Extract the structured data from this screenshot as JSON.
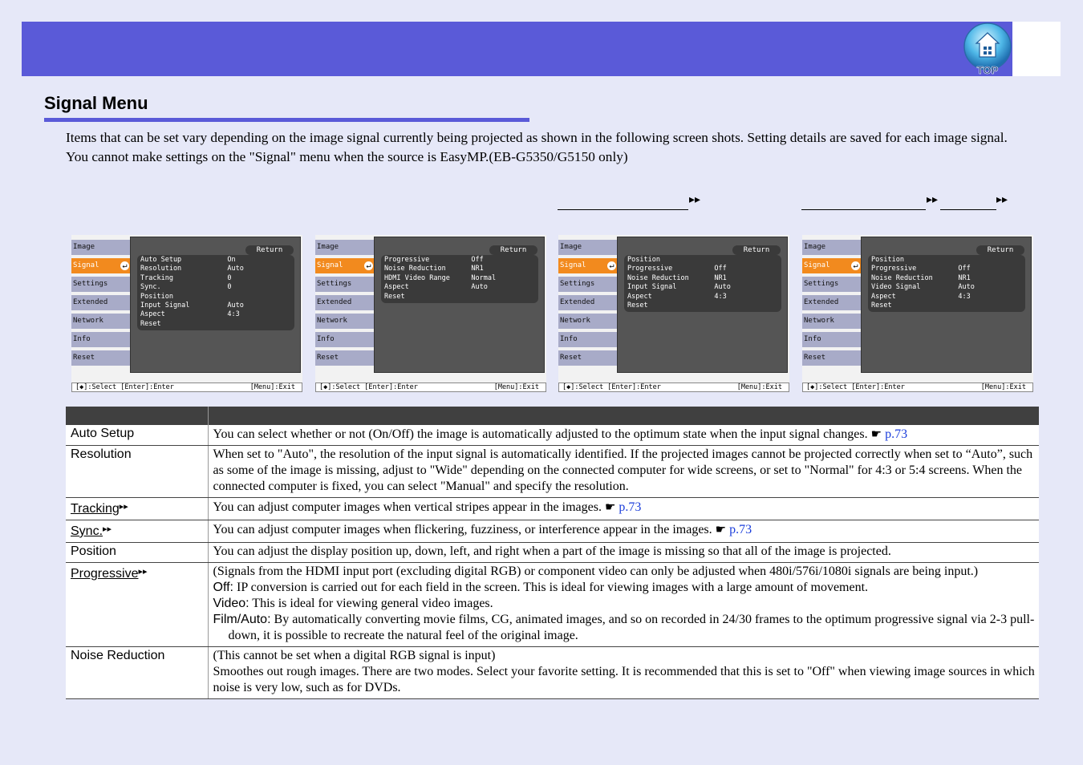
{
  "header": {
    "top_label": "TOP",
    "accent": "#5a5ad8"
  },
  "page_title": "Signal Menu",
  "intro": {
    "line1": "Items that can be set vary depending on the image signal currently being projected as shown in the following screen shots. Setting details are saved for each image signal.",
    "line2": "You cannot make settings on the \"Signal\" menu when the source is EasyMP.(EB-G5350/G5150 only)"
  },
  "links": {
    "arrow": "▸▸"
  },
  "screenshots": [
    {
      "side": [
        "Image",
        "Signal",
        "Settings",
        "Extended",
        "Network",
        "Info",
        "Reset"
      ],
      "return_label": "Return",
      "rows": [
        {
          "k": "Auto Setup",
          "v": "On"
        },
        {
          "k": "Resolution",
          "v": "Auto"
        },
        {
          "k": "Tracking",
          "v": "0"
        },
        {
          "k": "Sync.",
          "v": "0"
        },
        {
          "k": "Position",
          "v": ""
        },
        {
          "k": "Input Signal",
          "v": "Auto"
        },
        {
          "k": "Aspect",
          "v": "4:3"
        },
        {
          "k": "Reset",
          "v": ""
        }
      ],
      "footer_left": "[◆]:Select  [Enter]:Enter",
      "footer_right": "[Menu]:Exit"
    },
    {
      "side": [
        "Image",
        "Signal",
        "Settings",
        "Extended",
        "Network",
        "Info",
        "Reset"
      ],
      "return_label": "Return",
      "rows": [
        {
          "k": "Progressive",
          "v": "Off"
        },
        {
          "k": "Noise Reduction",
          "v": "NR1"
        },
        {
          "k": "HDMI Video Range",
          "v": "Normal"
        },
        {
          "k": "Aspect",
          "v": "Auto"
        },
        {
          "k": "Reset",
          "v": ""
        }
      ],
      "footer_left": "[◆]:Select  [Enter]:Enter",
      "footer_right": "[Menu]:Exit"
    },
    {
      "side": [
        "Image",
        "Signal",
        "Settings",
        "Extended",
        "Network",
        "Info",
        "Reset"
      ],
      "return_label": "Return",
      "rows": [
        {
          "k": "Position",
          "v": ""
        },
        {
          "k": "Progressive",
          "v": "Off"
        },
        {
          "k": "Noise Reduction",
          "v": "NR1"
        },
        {
          "k": "Input Signal",
          "v": "Auto"
        },
        {
          "k": "Aspect",
          "v": "4:3"
        },
        {
          "k": "Reset",
          "v": ""
        }
      ],
      "footer_left": "[◆]:Select  [Enter]:Enter",
      "footer_right": "[Menu]:Exit"
    },
    {
      "side": [
        "Image",
        "Signal",
        "Settings",
        "Extended",
        "Network",
        "Info",
        "Reset"
      ],
      "return_label": "Return",
      "rows": [
        {
          "k": "Position",
          "v": ""
        },
        {
          "k": "Progressive",
          "v": "Off"
        },
        {
          "k": "Noise Reduction",
          "v": "NR1"
        },
        {
          "k": "Video Signal",
          "v": "Auto"
        },
        {
          "k": "Aspect",
          "v": "4:3"
        },
        {
          "k": "Reset",
          "v": ""
        }
      ],
      "footer_left": "[◆]:Select  [Enter]:Enter",
      "footer_right": "[Menu]:Exit"
    }
  ],
  "table": {
    "rows": [
      {
        "name": "Auto Setup",
        "text": "You can select whether or not (On/Off) the image is automatically adjusted to the optimum state when the input signal changes.",
        "ref": "p.73"
      },
      {
        "name": "Resolution",
        "text": "When set to \"Auto\", the resolution of the input signal is automatically identified. If the projected images cannot be projected correctly when set to “Auto”, such as some of the image is missing, adjust to \"Wide\" depending on the connected computer for wide screens, or set to \"Normal\" for 4:3 or 5:4 screens. When the connected computer is fixed, you can select \"Manual\" and specify the resolution."
      },
      {
        "name": "Tracking",
        "text": "You can adjust computer images when vertical stripes appear in the images.",
        "ref": "p.73"
      },
      {
        "name": "Sync.",
        "text": "You can adjust computer images when flickering, fuzziness, or interference appear in the images.",
        "ref": "p.73"
      },
      {
        "name": "Position",
        "text": "You can adjust the display position up, down, left, and right when a part of the image is missing so that all of the image is projected."
      },
      {
        "name": "Progressive",
        "note": "(Signals from the HDMI input port (excluding digital RGB) or component video can only be adjusted when 480i/576i/1080i signals are being input.)",
        "opt1_label": "Off:",
        "opt1_text": " IP conversion is carried out for each field in the screen. This is ideal for viewing images with a large amount of movement.",
        "opt2_label": "Video:",
        "opt2_text": " This is ideal for viewing general video images.",
        "opt3_label": "Film/Auto:",
        "opt3_text": " By automatically converting movie films, CG, animated images, and so on recorded in 24/30 frames to the optimum progressive signal via 2-3 pull-down, it is possible to recreate the natural feel of the original image."
      },
      {
        "name": "Noise Reduction",
        "note": "(This cannot be set when a digital RGB signal is input)",
        "text": "Smoothes out rough images. There are two modes. Select your favorite setting. It is recommended that this is set to \"Off\" when viewing image sources in which noise is very low, such as for DVDs."
      }
    ],
    "ref_icon": "☛",
    "link_arrow": "▸▸"
  }
}
